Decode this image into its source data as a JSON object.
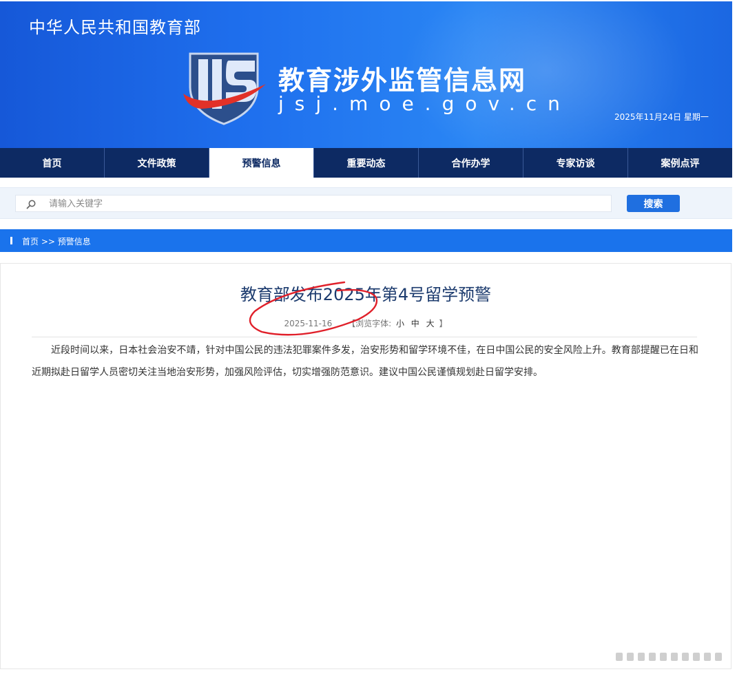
{
  "header": {
    "ministry_name": "中华人民共和国教育部",
    "site_title": "教育涉外监管信息网",
    "site_domain": "jsj.moe.gov.cn",
    "date": "2025年11月24日 星期一"
  },
  "nav": {
    "items": [
      {
        "label": "首页"
      },
      {
        "label": "文件政策"
      },
      {
        "label": "预警信息"
      },
      {
        "label": "重要动态"
      },
      {
        "label": "合作办学"
      },
      {
        "label": "专家访谈"
      },
      {
        "label": "案例点评"
      }
    ],
    "active_index": 2
  },
  "search": {
    "placeholder": "请输入关键字",
    "value": "",
    "button_label": "搜索",
    "icon": "search-icon"
  },
  "breadcrumb": {
    "home": "首页",
    "separator": ">>",
    "current": "预警信息"
  },
  "article": {
    "title": "教育部发布2025年第4号留学预警",
    "date": "2025-11-16",
    "font_size_label": "【浏览字体:",
    "font_sizes": [
      "小",
      "中",
      "大"
    ],
    "font_size_close": "】",
    "body": "近段时间以来，日本社会治安不靖，针对中国公民的违法犯罪案件多发，治安形势和留学环境不佳，在日中国公民的安全风险上升。教育部提醒已在日和近期拟赴日留学人员密切关注当地治安形势，加强风险评估，切实增强防范意识。建议中国公民谨慎规划赴日留学安排。"
  },
  "colors": {
    "banner": "#1f70ee",
    "nav": "#0d2a63",
    "breadcrumb": "#1a73ec",
    "button": "#1f6fe0",
    "title": "#1c3b6e",
    "annotation": "#e0202a"
  }
}
